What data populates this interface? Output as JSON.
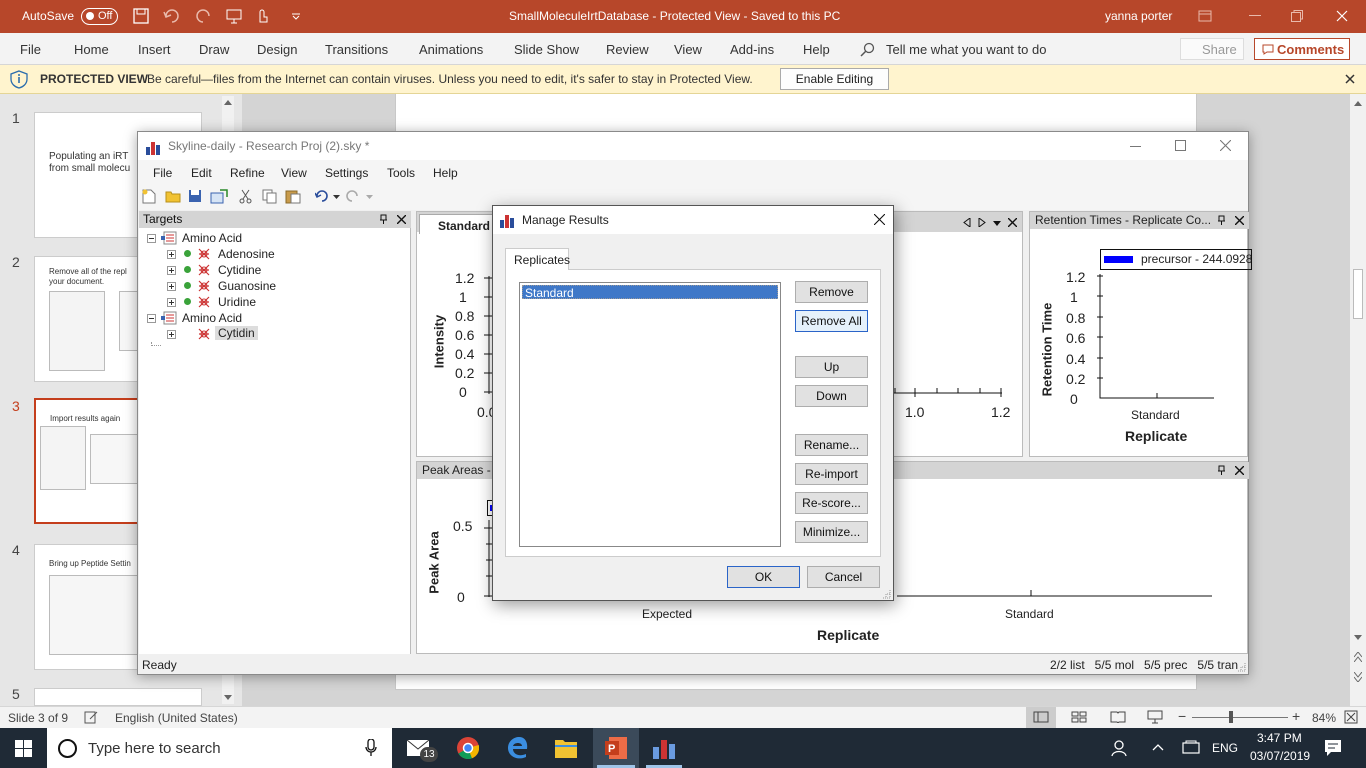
{
  "ppt": {
    "autosave_label": "AutoSave",
    "autosave_state": "Off",
    "title": "SmallMoleculeIrtDatabase  -  Protected View  -  Saved to this PC",
    "user": "yanna porter",
    "tabs": [
      "File",
      "Home",
      "Insert",
      "Draw",
      "Design",
      "Transitions",
      "Animations",
      "Slide Show",
      "Review",
      "View",
      "Add-ins",
      "Help"
    ],
    "tell_me": "Tell me what you want to do",
    "share": "Share",
    "comments": "Comments",
    "protected_title": "PROTECTED VIEW",
    "protected_msg": "Be careful—files from the Internet can contain viruses. Unless you need to edit, it's safer to stay in Protected View.",
    "enable_editing": "Enable Editing",
    "slides": [
      {
        "num": "1",
        "text": "Populating an iRT\nfrom small molecu"
      },
      {
        "num": "2",
        "text": "Remove all of the repl\nyour document."
      },
      {
        "num": "3",
        "text": "Import results again"
      },
      {
        "num": "4",
        "text": "Bring up Peptide Settin"
      },
      {
        "num": "5",
        "text": ""
      }
    ],
    "status_slide": "Slide 3 of 9",
    "status_lang": "English (United States)",
    "zoom": "84%"
  },
  "skyline": {
    "title": "Skyline-daily - Research Proj (2).sky *",
    "menu": [
      "File",
      "Edit",
      "Refine",
      "View",
      "Settings",
      "Tools",
      "Help"
    ],
    "targets_title": "Targets",
    "tree": [
      {
        "label": "Amino Acid",
        "level": 0
      },
      {
        "label": "Adenosine",
        "level": 1
      },
      {
        "label": "Cytidine",
        "level": 1
      },
      {
        "label": "Guanosine",
        "level": 1
      },
      {
        "label": "Uridine",
        "level": 1
      },
      {
        "label": "Amino Acid",
        "level": 0
      },
      {
        "label": "Cytidin",
        "level": 1
      }
    ],
    "chrom_tab": "Standard",
    "chrom_ylabel": "Intensity",
    "chrom_yticks": [
      "1.2",
      "1",
      "0.8",
      "0.6",
      "0.4",
      "0.2",
      "0"
    ],
    "chrom_xticks": [
      "0.0",
      "1.0",
      "1.2"
    ],
    "rt_title": "Retention Times - Replicate Co...",
    "rt_legend": "precursor - 244.0928",
    "rt_ylabel": "Retention Time",
    "rt_yticks": [
      "1.2",
      "1",
      "0.8",
      "0.6",
      "0.4",
      "0.2",
      "0"
    ],
    "rt_xtick": "Standard",
    "rt_xlabel": "Replicate",
    "peak_title": "Peak Areas - R",
    "peak_ylabel": "Peak Area",
    "peak_yticks": [
      "0.5",
      "0"
    ],
    "peak_xticks": [
      "Expected",
      "Standard"
    ],
    "peak_xlabel": "Replicate",
    "status_ready": "Ready",
    "status_counts": "2/2 list   5/5 mol   5/5 prec   5/5 tran"
  },
  "dialog": {
    "title": "Manage Results",
    "tab": "Replicates",
    "replicates": [
      "Standard"
    ],
    "buttons": {
      "remove": "Remove",
      "remove_all": "Remove All",
      "up": "Up",
      "down": "Down",
      "rename": "Rename...",
      "reimport": "Re-import",
      "rescore": "Re-score...",
      "minimize": "Minimize...",
      "ok": "OK",
      "cancel": "Cancel"
    }
  },
  "taskbar": {
    "search": "Type here to search",
    "mail_badge": "13",
    "lang": "ENG",
    "time": "3:47 PM",
    "date": "03/07/2019"
  }
}
